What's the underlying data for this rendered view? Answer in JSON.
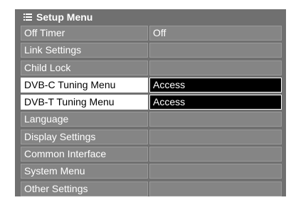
{
  "menu": {
    "title": "Setup Menu",
    "icon": "menu-list-icon"
  },
  "items": [
    {
      "label": "Off Timer",
      "value": "Off"
    },
    {
      "label": "Link Settings",
      "value": ""
    },
    {
      "label": "Child Lock",
      "value": ""
    },
    {
      "label": "DVB-C Tuning Menu",
      "value": "Access"
    },
    {
      "label": "DVB-T Tuning Menu",
      "value": "Access"
    },
    {
      "label": "Language",
      "value": ""
    },
    {
      "label": "Display Settings",
      "value": ""
    },
    {
      "label": "Common Interface",
      "value": ""
    },
    {
      "label": "System Menu",
      "value": ""
    },
    {
      "label": "Other Settings",
      "value": ""
    }
  ],
  "colors": {
    "panel": "#707070",
    "cell": "#858585",
    "highlight_label": "#ffffff",
    "highlight_value": "#000000"
  }
}
